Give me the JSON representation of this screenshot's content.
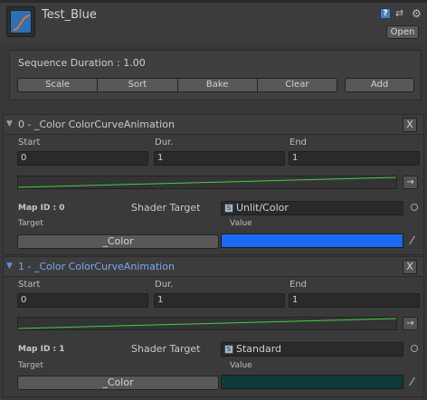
{
  "header": {
    "title": "Test_Blue",
    "open_label": "Open",
    "icons": [
      "curve-asset-icon",
      "help-icon",
      "preset-icon",
      "gear-icon"
    ]
  },
  "sequence": {
    "duration_label": "Sequence Duration : 1.00",
    "buttons": [
      "Scale",
      "Sort",
      "Bake",
      "Clear"
    ],
    "add_label": "Add"
  },
  "animations": [
    {
      "title": "0 - _Color ColorCurveAnimation",
      "close_label": "X",
      "start_label": "Start",
      "dur_label": "Dur.",
      "end_label": "End",
      "start": "0",
      "dur": "1",
      "end": "1",
      "arrow_label": "→",
      "mapid": "Map ID : 0",
      "shader_target_label": "Shader Target",
      "shader": "Unlit/Color",
      "target_label": "Target",
      "value_label": "Value",
      "target": "_Color",
      "color": "#1a6aef",
      "curve_color": "#3fd13f"
    },
    {
      "title": "1 - _Color ColorCurveAnimation",
      "close_label": "X",
      "start_label": "Start",
      "dur_label": "Dur.",
      "end_label": "End",
      "start": "0",
      "dur": "1",
      "end": "1",
      "arrow_label": "→",
      "mapid": "Map ID : 1",
      "shader_target_label": "Shader Target",
      "shader": "Standard",
      "target_label": "Target",
      "value_label": "Value",
      "target": "_Color",
      "color": "#0f3a3c",
      "curve_color": "#3fd13f"
    }
  ]
}
